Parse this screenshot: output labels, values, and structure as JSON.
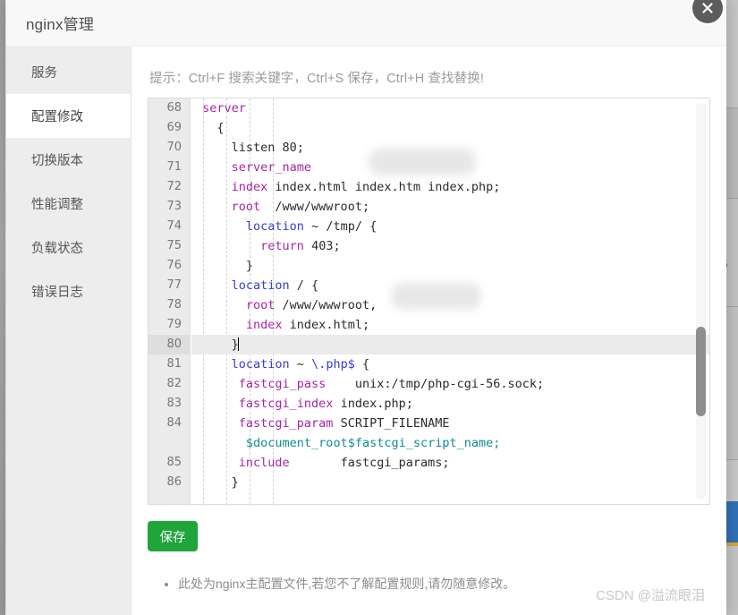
{
  "window": {
    "title": "nginx管理",
    "close_icon": "close-circle-icon"
  },
  "sidebar": {
    "items": [
      {
        "label": "服务",
        "active": false
      },
      {
        "label": "配置修改",
        "active": true
      },
      {
        "label": "切换版本",
        "active": false
      },
      {
        "label": "性能调整",
        "active": false
      },
      {
        "label": "负载状态",
        "active": false
      },
      {
        "label": "错误日志",
        "active": false
      }
    ]
  },
  "content": {
    "hint": "提示：Ctrl+F 搜索关键字，Ctrl+S 保存，Ctrl+H 查找替换!",
    "save_label": "保存",
    "notes": [
      "此处为nginx主配置文件,若您不了解配置规则,请勿随意修改。"
    ]
  },
  "editor": {
    "first_line": 68,
    "active_line": 80,
    "scroll_thumb_top_pct": 73,
    "lines": [
      {
        "n": 68,
        "indent": 0,
        "tokens": [
          {
            "t": "server",
            "c": "kw"
          }
        ]
      },
      {
        "n": 69,
        "indent": 1,
        "tokens": [
          {
            "t": "{",
            "c": "plain"
          }
        ]
      },
      {
        "n": 70,
        "indent": 2,
        "tokens": [
          {
            "t": "listen 80;",
            "c": "plain"
          }
        ]
      },
      {
        "n": 71,
        "indent": 2,
        "tokens": [
          {
            "t": "server_name",
            "c": "kw"
          }
        ],
        "redacted": true
      },
      {
        "n": 72,
        "indent": 2,
        "tokens": [
          {
            "t": "index",
            "c": "kw"
          },
          {
            "t": " index.html index.htm index.php;",
            "c": "plain"
          }
        ]
      },
      {
        "n": 73,
        "indent": 2,
        "tokens": [
          {
            "t": "root",
            "c": "kw"
          },
          {
            "t": "  /www/wwwroot;",
            "c": "plain"
          }
        ]
      },
      {
        "n": 74,
        "indent": 3,
        "tokens": [
          {
            "t": "location",
            "c": "blue"
          },
          {
            "t": " ~ /tmp/ {",
            "c": "plain"
          }
        ]
      },
      {
        "n": 75,
        "indent": 4,
        "tokens": [
          {
            "t": "return",
            "c": "kw"
          },
          {
            "t": " 403;",
            "c": "plain"
          }
        ]
      },
      {
        "n": 76,
        "indent": 3,
        "tokens": [
          {
            "t": "}",
            "c": "plain"
          }
        ]
      },
      {
        "n": 77,
        "indent": 2,
        "tokens": [
          {
            "t": "location",
            "c": "blue"
          },
          {
            "t": " / {",
            "c": "plain"
          }
        ]
      },
      {
        "n": 78,
        "indent": 3,
        "tokens": [
          {
            "t": "root",
            "c": "kw"
          },
          {
            "t": " /www/wwwroot,",
            "c": "plain"
          }
        ],
        "redacted": true
      },
      {
        "n": 79,
        "indent": 3,
        "tokens": [
          {
            "t": "index",
            "c": "kw"
          },
          {
            "t": " index.html;",
            "c": "plain"
          }
        ]
      },
      {
        "n": 80,
        "indent": 2,
        "tokens": [
          {
            "t": "}",
            "c": "plain"
          }
        ],
        "caret": true
      },
      {
        "n": 81,
        "indent": 2,
        "tokens": [
          {
            "t": "location",
            "c": "blue"
          },
          {
            "t": " ~ ",
            "c": "plain"
          },
          {
            "t": "\\.php$",
            "c": "blue"
          },
          {
            "t": " {",
            "c": "plain"
          }
        ]
      },
      {
        "n": 82,
        "indent": 2,
        "tokens": [
          {
            "t": " fastcgi_pass",
            "c": "kw"
          },
          {
            "t": "    unix:/tmp/php-cgi-56.sock;",
            "c": "plain"
          }
        ]
      },
      {
        "n": 83,
        "indent": 2,
        "tokens": [
          {
            "t": " fastcgi_index",
            "c": "kw"
          },
          {
            "t": " index.php;",
            "c": "plain"
          }
        ]
      },
      {
        "n": 84,
        "indent": 2,
        "tokens": [
          {
            "t": " fastcgi_param",
            "c": "kw"
          },
          {
            "t": " SCRIPT_FILENAME",
            "c": "plain"
          }
        ]
      },
      {
        "n": "",
        "indent": 3,
        "tokens": [
          {
            "t": "$document_root$fastcgi_script_name;",
            "c": "teal"
          }
        ]
      },
      {
        "n": 85,
        "indent": 2,
        "tokens": [
          {
            "t": " include",
            "c": "kw"
          },
          {
            "t": "       fastcgi_params;",
            "c": "plain"
          }
        ]
      },
      {
        "n": 86,
        "indent": 2,
        "tokens": [
          {
            "t": "}",
            "c": "plain"
          }
        ]
      }
    ]
  },
  "watermark": "CSDN @溢流眼泪",
  "colors": {
    "accent_green": "#20a53a",
    "sidebar_bg": "#ededed",
    "gutter_bg": "#ebebeb",
    "keyword": "#a626a4",
    "location": "#3a3ad6",
    "variable": "#0f8c96"
  }
}
